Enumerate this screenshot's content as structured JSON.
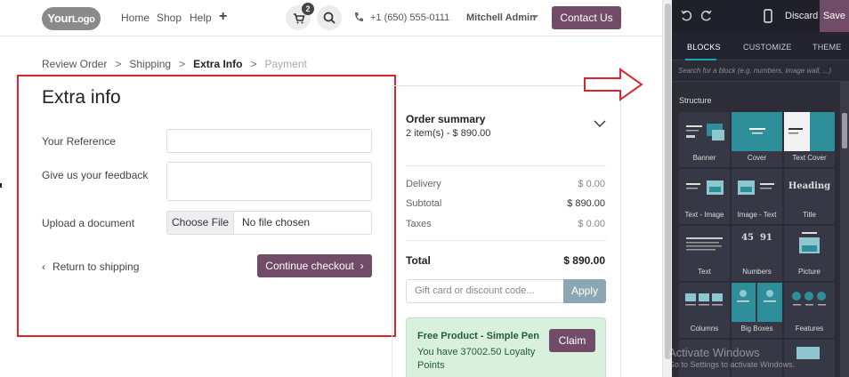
{
  "navbar": {
    "logo_text": "Your",
    "logo_text_2": "Logo",
    "links": [
      "Home",
      "Shop",
      "Help"
    ],
    "cart_count": "2",
    "phone": "+1 (650) 555-0111",
    "user": "Mitchell Admin",
    "contact_label": "Contact Us"
  },
  "breadcrumb": {
    "steps": [
      "Review Order",
      "Shipping",
      "Extra Info",
      "Payment"
    ],
    "separator": ">"
  },
  "extra_info": {
    "title": "Extra info",
    "reference_label": "Your Reference",
    "reference_value": "",
    "feedback_label": "Give us your feedback",
    "feedback_value": "",
    "upload_label": "Upload a document",
    "file_button": "Choose File",
    "file_status": "No file chosen",
    "return_link": "Return to shipping",
    "continue_label": "Continue checkout",
    "chevron_left": "‹",
    "chevron_right": "›"
  },
  "summary": {
    "title": "Order summary",
    "items": "2  item(s) -  $ 890.00",
    "rows": [
      {
        "label": "Delivery",
        "value": "$ 0.00"
      },
      {
        "label": "Subtotal",
        "value": "$ 890.00"
      },
      {
        "label": "Taxes",
        "value": "$ 0.00"
      }
    ],
    "total_label": "Total",
    "total_value": "$ 890.00",
    "promo_placeholder": "Gift card or discount code...",
    "apply_label": "Apply",
    "reward_title": "Free Product - Simple Pen",
    "reward_text": "You have 37002.50 Loyalty Points",
    "claim_label": "Claim"
  },
  "editor": {
    "discard_label": "Discard",
    "save_label": "Save",
    "tabs": [
      "BLOCKS",
      "CUSTOMIZE",
      "THEME"
    ],
    "search_placeholder": "Search for a block (e.g. numbers, image wall, ...)",
    "section_title": "Structure",
    "blocks": [
      "Banner",
      "Cover",
      "Text Cover",
      "Text - Image",
      "Image - Text",
      "Title",
      "Text",
      "Numbers",
      "Picture",
      "Columns",
      "Big Boxes",
      "Features"
    ],
    "title_block_text": "Heading",
    "numbers_block_text": "45  91"
  },
  "watermark": {
    "line1": "Activate Windows",
    "line2": "Go to Settings to activate Windows."
  },
  "colors": {
    "brand": "#714b67",
    "annotation_red": "#d9262e",
    "editor_bg": "#2c2d36",
    "accent_teal": "#19a4bd"
  }
}
